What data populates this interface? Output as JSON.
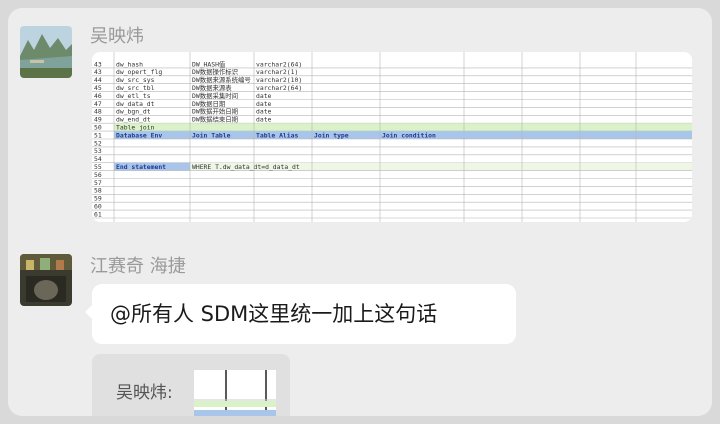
{
  "messages": [
    {
      "sender": "吴映炜",
      "avatar_icon": "landscape-avatar-icon"
    },
    {
      "sender": "江赛奇 海捷",
      "avatar_icon": "room-avatar-icon",
      "text": "@所有人 SDM这里统一加上这句话"
    }
  ],
  "quote": {
    "sender_label": "吴映炜:"
  },
  "spreadsheet": {
    "colors": {
      "header": "#a9c6ea",
      "header_text": "#1f3a8f",
      "section": "#d9f2c8",
      "end": "#a9c6ea",
      "grid": "#b6b6b6"
    },
    "rows": [
      {
        "num": "43",
        "cells": [
          "dw_hash",
          "DW_HASH值",
          "varchar2(64)"
        ]
      },
      {
        "num": "43",
        "cells": [
          "dw_opert_flg",
          "DW数据操作标识",
          "varchar2(1)"
        ]
      },
      {
        "num": "44",
        "cells": [
          "dw_src_sys",
          "DW数据来源系统编号",
          "varchar2(10)"
        ]
      },
      {
        "num": "45",
        "cells": [
          "dw_src_tbl",
          "DW数据来源表",
          "varchar2(64)"
        ]
      },
      {
        "num": "46",
        "cells": [
          "dw_etl_ts",
          "DW数据采集时间",
          "date"
        ]
      },
      {
        "num": "47",
        "cells": [
          "dw_data_dt",
          "DW数据日期",
          "date"
        ]
      },
      {
        "num": "48",
        "cells": [
          "dw_bgn_dt",
          "DW数据开始日期",
          "date"
        ]
      },
      {
        "num": "49",
        "cells": [
          "dw_end_dt",
          "DW数据结束日期",
          "date"
        ]
      },
      {
        "num": "50",
        "type": "section",
        "cells": [
          "Table join"
        ]
      },
      {
        "num": "51",
        "type": "header",
        "cells": [
          "Database Env",
          "Join Table",
          "Table Alias",
          "Join type",
          "Join condition"
        ]
      },
      {
        "num": "52",
        "cells": []
      },
      {
        "num": "53",
        "cells": []
      },
      {
        "num": "54",
        "cells": []
      },
      {
        "num": "55",
        "type": "end",
        "cells": [
          "End statement",
          "WHERE T.dw_data_dt=d_data_dt"
        ]
      },
      {
        "num": "56",
        "cells": []
      },
      {
        "num": "57",
        "cells": []
      },
      {
        "num": "58",
        "cells": []
      },
      {
        "num": "59",
        "cells": []
      },
      {
        "num": "60",
        "cells": []
      },
      {
        "num": "61",
        "cells": []
      }
    ]
  }
}
